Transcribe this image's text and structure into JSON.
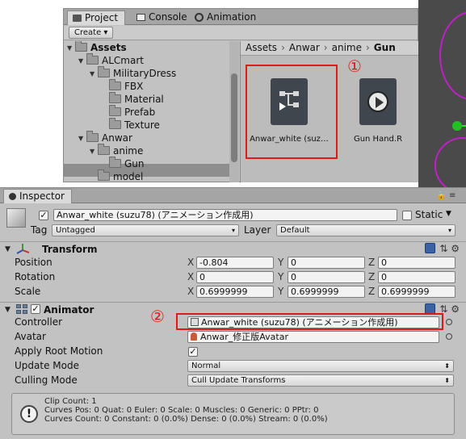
{
  "project": {
    "tabs": [
      {
        "label": "Project",
        "active": true
      },
      {
        "label": "Console",
        "active": false
      },
      {
        "label": "Animation",
        "active": false
      }
    ],
    "create_label": "Create ▾",
    "tree": [
      {
        "label": "Assets",
        "bold": true
      },
      {
        "label": "ALCmart"
      },
      {
        "label": "MilitaryDress"
      },
      {
        "label": "FBX"
      },
      {
        "label": "Material"
      },
      {
        "label": "Prefab"
      },
      {
        "label": "Texture"
      },
      {
        "label": "Anwar"
      },
      {
        "label": "anime"
      },
      {
        "label": "Gun",
        "selected": true
      },
      {
        "label": "model"
      }
    ],
    "breadcrumb": [
      "Assets",
      "Anwar",
      "anime",
      "Gun"
    ],
    "assets": [
      {
        "label": "Anwar_white (suz…",
        "icon": "animator-controller-icon"
      },
      {
        "label": "Gun Hand.R",
        "icon": "animation-clip-icon"
      }
    ]
  },
  "annotations": {
    "marker1": "①",
    "marker2": "②",
    "color": "#e01818"
  },
  "inspector": {
    "tab_label": "Inspector",
    "tab_controls": "≡",
    "object_name": "Anwar_white (suzu78) (アニメーション作成用)",
    "static_label": "Static",
    "tag_label": "Tag",
    "tag_value": "Untagged",
    "layer_label": "Layer",
    "layer_value": "Default",
    "transform": {
      "title": "Transform",
      "rows": [
        {
          "label": "Position",
          "x": "-0.804",
          "y": "0",
          "z": "0"
        },
        {
          "label": "Rotation",
          "x": "0",
          "y": "0",
          "z": "0"
        },
        {
          "label": "Scale",
          "x": "0.6999999",
          "y": "0.6999999",
          "z": "0.6999999"
        }
      ],
      "axis_x": "X",
      "axis_y": "Y",
      "axis_z": "Z"
    },
    "animator": {
      "title": "Animator",
      "controller_label": "Controller",
      "controller_value": "Anwar_white (suzu78) (アニメーション作成用)",
      "avatar_label": "Avatar",
      "avatar_value": "Anwar_修正版Avatar",
      "apply_root_motion_label": "Apply Root Motion",
      "apply_root_motion": true,
      "update_mode_label": "Update Mode",
      "update_mode_value": "Normal",
      "culling_mode_label": "Culling Mode",
      "culling_mode_value": "Cull Update Transforms",
      "info_lines": [
        "Clip Count: 1",
        "Curves Pos: 0 Quat: 0 Euler: 0 Scale: 0 Muscles: 0 Generic: 0 PPtr: 0",
        "Curves Count: 0 Constant: 0 (0.0%) Dense: 0 (0.0%) Stream: 0 (0.0%)"
      ]
    }
  }
}
